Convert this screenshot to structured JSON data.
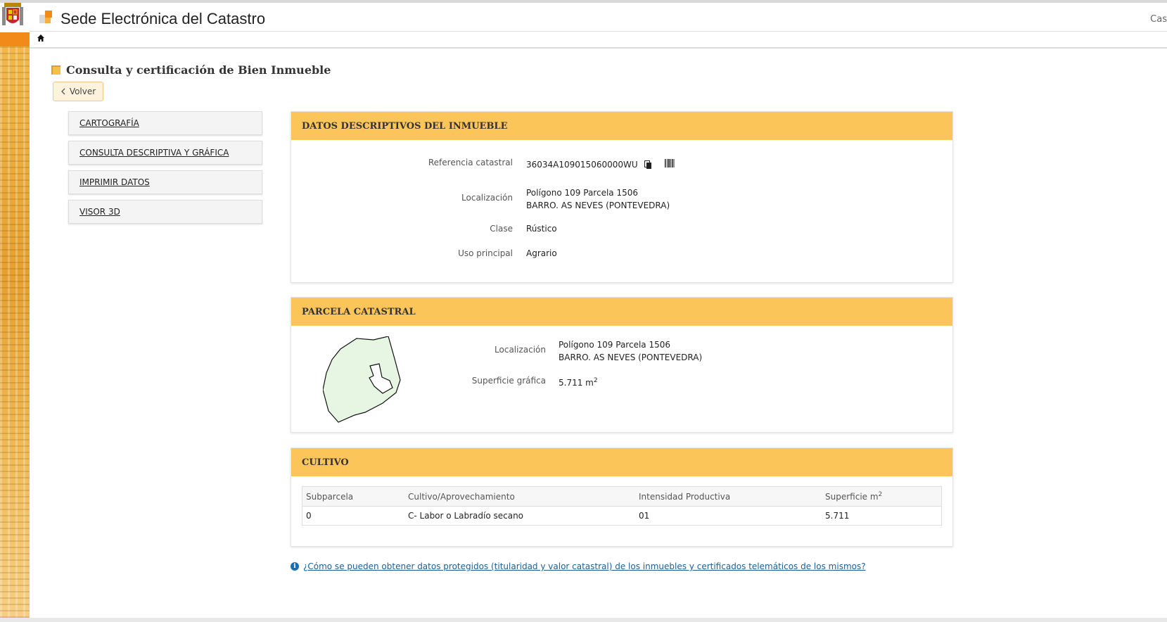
{
  "header": {
    "site_title": "Sede Electrónica del Catastro",
    "lang": "Cas"
  },
  "page": {
    "title": "Consulta y certificación de Bien Inmueble",
    "back_label": "Volver"
  },
  "sidemenu": {
    "items": [
      {
        "label": "CARTOGRAFÍA"
      },
      {
        "label": "CONSULTA DESCRIPTIVA Y GRÁFICA"
      },
      {
        "label": "IMPRIMIR DATOS"
      },
      {
        "label": "VISOR 3D"
      }
    ]
  },
  "datos": {
    "heading": "DATOS DESCRIPTIVOS DEL INMUEBLE",
    "ref_label": "Referencia catastral",
    "ref_value": "36034A109015060000WU",
    "loc_label": "Localización",
    "loc_line1": "Polígono 109 Parcela 1506",
    "loc_line2": "BARRO. AS NEVES (PONTEVEDRA)",
    "clase_label": "Clase",
    "clase_value": "Rústico",
    "uso_label": "Uso principal",
    "uso_value": "Agrario"
  },
  "parcela": {
    "heading": "PARCELA CATASTRAL",
    "loc_label": "Localización",
    "loc_line1": "Polígono 109 Parcela 1506",
    "loc_line2": "BARRO. AS NEVES (PONTEVEDRA)",
    "sup_label": "Superficie gráfica",
    "sup_value": "5.711 m",
    "sup_exp": "2",
    "parcel_fill": "#e6f6e2"
  },
  "cultivo": {
    "heading": "CULTIVO",
    "columns": [
      "Subparcela",
      "Cultivo/Aprovechamiento",
      "Intensidad Productiva",
      "Superficie m"
    ],
    "col_exp": "2",
    "rows": [
      [
        "0",
        "C- Labor o Labradío secano",
        "01",
        "5.711"
      ]
    ]
  },
  "info_link": "¿Cómo se pueden obtener datos protegidos (titularidad y valor catastral) de los inmuebles y certificados telemáticos de los mismos?",
  "colors": {
    "panel_header": "#fcc55a",
    "accent_orange": "#f28a1a",
    "link": "#1a5f96"
  }
}
